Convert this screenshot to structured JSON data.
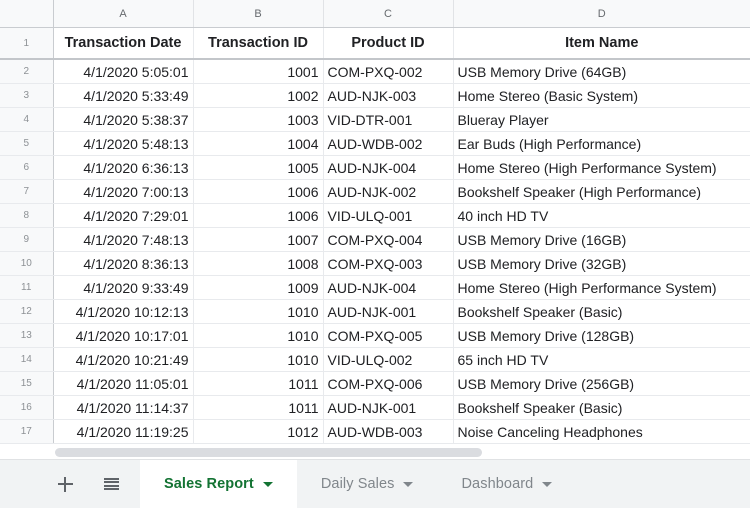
{
  "spreadsheet": {
    "columns": [
      {
        "letter": "A",
        "header": "Transaction Date",
        "align": "right"
      },
      {
        "letter": "B",
        "header": "Transaction ID",
        "align": "right"
      },
      {
        "letter": "C",
        "header": "Product ID",
        "align": "left"
      },
      {
        "letter": "D",
        "header": "Item Name",
        "align": "left"
      }
    ],
    "header_row_number": "1",
    "rows": [
      {
        "num": "2",
        "a": "4/1/2020 5:05:01",
        "b": "1001",
        "c": "COM-PXQ-002",
        "d": "USB Memory Drive (64GB)"
      },
      {
        "num": "3",
        "a": "4/1/2020 5:33:49",
        "b": "1002",
        "c": "AUD-NJK-003",
        "d": "Home Stereo (Basic System)"
      },
      {
        "num": "4",
        "a": "4/1/2020 5:38:37",
        "b": "1003",
        "c": "VID-DTR-001",
        "d": "Blueray Player"
      },
      {
        "num": "5",
        "a": "4/1/2020 5:48:13",
        "b": "1004",
        "c": "AUD-WDB-002",
        "d": "Ear Buds (High Performance)"
      },
      {
        "num": "6",
        "a": "4/1/2020 6:36:13",
        "b": "1005",
        "c": "AUD-NJK-004",
        "d": "Home Stereo (High Performance System)"
      },
      {
        "num": "7",
        "a": "4/1/2020 7:00:13",
        "b": "1006",
        "c": "AUD-NJK-002",
        "d": "Bookshelf Speaker (High Performance)"
      },
      {
        "num": "8",
        "a": "4/1/2020 7:29:01",
        "b": "1006",
        "c": "VID-ULQ-001",
        "d": "40 inch HD TV"
      },
      {
        "num": "9",
        "a": "4/1/2020 7:48:13",
        "b": "1007",
        "c": "COM-PXQ-004",
        "d": "USB Memory Drive (16GB)"
      },
      {
        "num": "10",
        "a": "4/1/2020 8:36:13",
        "b": "1008",
        "c": "COM-PXQ-003",
        "d": "USB Memory Drive (32GB)"
      },
      {
        "num": "11",
        "a": "4/1/2020 9:33:49",
        "b": "1009",
        "c": "AUD-NJK-004",
        "d": "Home Stereo (High Performance System)"
      },
      {
        "num": "12",
        "a": "4/1/2020 10:12:13",
        "b": "1010",
        "c": "AUD-NJK-001",
        "d": "Bookshelf Speaker (Basic)"
      },
      {
        "num": "13",
        "a": "4/1/2020 10:17:01",
        "b": "1010",
        "c": "COM-PXQ-005",
        "d": "USB Memory Drive (128GB)"
      },
      {
        "num": "14",
        "a": "4/1/2020 10:21:49",
        "b": "1010",
        "c": "VID-ULQ-002",
        "d": "65 inch HD TV"
      },
      {
        "num": "15",
        "a": "4/1/2020 11:05:01",
        "b": "1011",
        "c": "COM-PXQ-006",
        "d": "USB Memory Drive (256GB)"
      },
      {
        "num": "16",
        "a": "4/1/2020 11:14:37",
        "b": "1011",
        "c": "AUD-NJK-001",
        "d": "Bookshelf Speaker (Basic)"
      },
      {
        "num": "17",
        "a": "4/1/2020 11:19:25",
        "b": "1012",
        "c": "AUD-WDB-003",
        "d": "Noise Canceling Headphones"
      }
    ]
  },
  "tabbar": {
    "add_sheet_icon": "plus-icon",
    "all_sheets_icon": "hamburger-menu-icon",
    "tabs": [
      {
        "label": "Sales Report",
        "active": true
      },
      {
        "label": "Daily Sales",
        "active": false
      },
      {
        "label": "Dashboard",
        "active": false
      }
    ]
  },
  "colors": {
    "active_tab_text": "#137333",
    "inactive_tab_text": "#80868b",
    "tabbar_background": "#f1f3f4",
    "header_background": "#f8f9fa",
    "grid_line": "#e8eaed"
  }
}
